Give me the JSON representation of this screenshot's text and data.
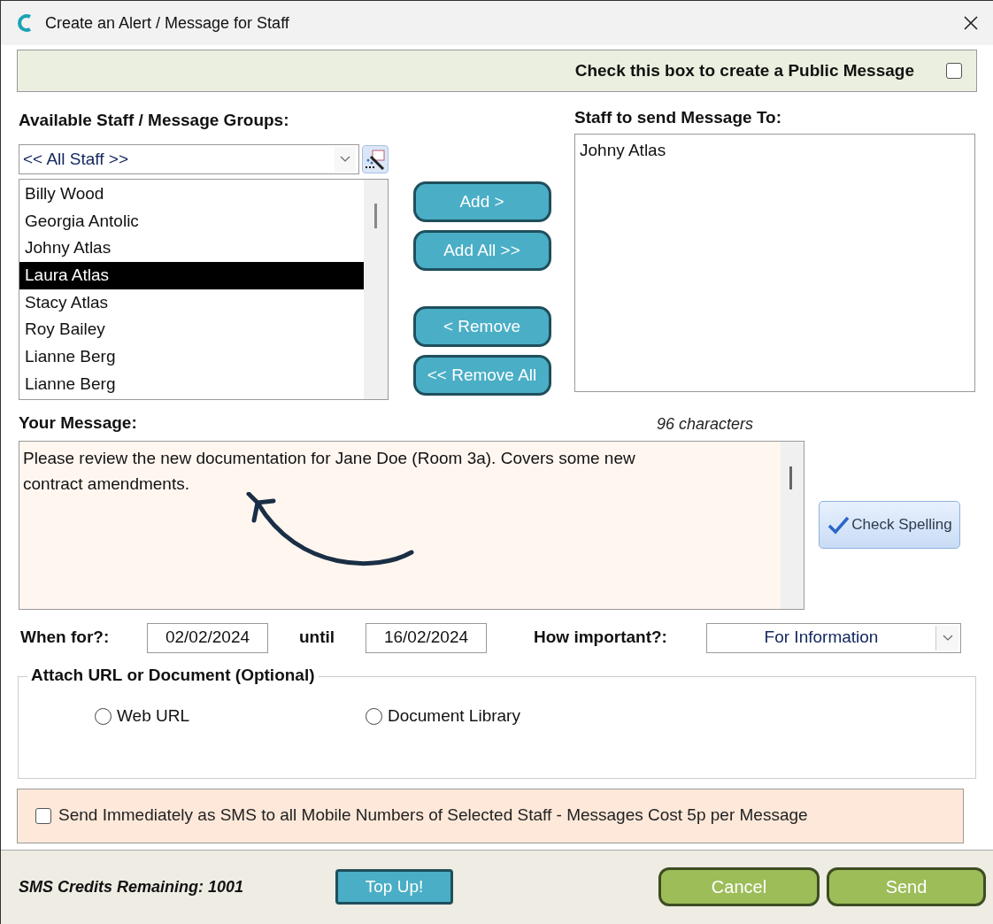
{
  "window": {
    "title": "Create an Alert / Message for Staff"
  },
  "public_message": {
    "label": "Check this box to create a Public Message",
    "checked": false
  },
  "available": {
    "label": "Available Staff / Message Groups:",
    "group_value": "<< All Staff >>",
    "staff": [
      {
        "name": "Billy Wood",
        "selected": false
      },
      {
        "name": "Georgia Antolic",
        "selected": false
      },
      {
        "name": "Johny Atlas",
        "selected": false
      },
      {
        "name": "Laura Atlas",
        "selected": true
      },
      {
        "name": "Stacy Atlas",
        "selected": false
      },
      {
        "name": "Roy Bailey",
        "selected": false
      },
      {
        "name": "Lianne Berg",
        "selected": false
      },
      {
        "name": "Lianne Berg",
        "selected": false
      }
    ]
  },
  "transfer_buttons": [
    "Add >",
    "Add All >>",
    "< Remove",
    "<< Remove All"
  ],
  "recipients": {
    "label": "Staff to send Message To:",
    "items": [
      "Johny Atlas"
    ]
  },
  "message": {
    "label": "Your Message:",
    "count": "96 characters",
    "value": "Please review the new documentation for Jane Doe (Room 3a). Covers some new contract amendments.",
    "spell_button": "Check Spelling"
  },
  "dates": {
    "from_label": "When for?:",
    "from": "02/02/2024",
    "until_label": "until",
    "until": "16/02/2024",
    "importance_label": "How important?:",
    "importance": "For Information"
  },
  "attach": {
    "legend": "Attach URL or Document (Optional)",
    "options": [
      {
        "label": "Web URL",
        "selected": false
      },
      {
        "label": "Document Library",
        "selected": false
      }
    ]
  },
  "sms": {
    "label": "Send Immediately as SMS to all Mobile Numbers of Selected Staff - Messages Cost 5p per Message",
    "checked": false
  },
  "footer": {
    "credits": "SMS Credits Remaining: 1001",
    "top_up": "Top Up!",
    "cancel": "Cancel",
    "send": "Send"
  }
}
